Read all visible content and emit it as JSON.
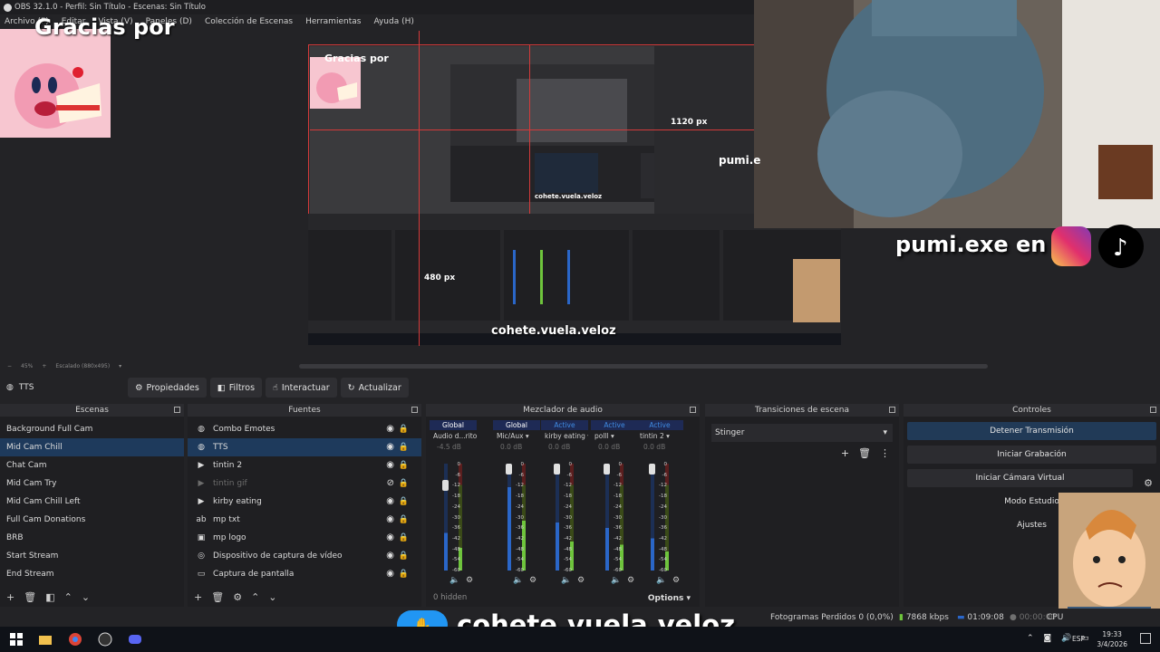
{
  "window": {
    "title": "OBS 32.1.0 - Perfil: Sin Título - Escenas: Sin Título"
  },
  "menu": [
    "Archivo (F)",
    "Editar",
    "Vista (V)",
    "Paneles (D)",
    "Colección de Escenas",
    "Herramientas",
    "Ayuda (H)"
  ],
  "overlay": {
    "gracias": "Gracias     por",
    "pumi_tag": "pumi.exe en",
    "pumi_small": "pumi.e",
    "px_1120": "1120 px",
    "px_480": "480 px",
    "cohete": "cohete.vuela.veloz"
  },
  "preview_status": {
    "zoom": "45%",
    "scaled": "Escalado (880x495)"
  },
  "source_toolbar": {
    "current_source": "TTS",
    "buttons": [
      "Propiedades",
      "Filtros",
      "Interactuar",
      "Actualizar"
    ]
  },
  "scenes": {
    "title": "Escenas",
    "items": [
      "Background Full Cam",
      "Mid Cam Chill",
      "Chat Cam",
      "Mid Cam Try",
      "Mid Cam Chill Left",
      "Full Cam Donations",
      "BRB",
      "Start Stream",
      "End Stream"
    ],
    "active_index": 1
  },
  "sources": {
    "title": "Fuentes",
    "items": [
      {
        "label": "Combo Emotes",
        "icon": "browser-icon",
        "glyph": "◍",
        "dim": false
      },
      {
        "label": "TTS",
        "icon": "browser-icon",
        "glyph": "◍",
        "dim": false
      },
      {
        "label": "tintin 2",
        "icon": "media-play-icon",
        "glyph": "▶",
        "dim": false
      },
      {
        "label": "tintin gif",
        "icon": "media-play-icon",
        "glyph": "▶",
        "dim": true
      },
      {
        "label": "kirby eating",
        "icon": "media-play-icon",
        "glyph": "▶",
        "dim": false
      },
      {
        "label": "mp txt",
        "icon": "text-icon",
        "glyph": "ab",
        "dim": false
      },
      {
        "label": "mp logo",
        "icon": "image-icon",
        "glyph": "▣",
        "dim": false
      },
      {
        "label": "Dispositivo de captura de vídeo",
        "icon": "camera-icon",
        "glyph": "◎",
        "dim": false
      },
      {
        "label": "Captura de pantalla",
        "icon": "monitor-icon",
        "glyph": "▭",
        "dim": false
      }
    ],
    "active_index": 1
  },
  "mixer": {
    "title": "Mezclador de audio",
    "channels": [
      {
        "head": "Global",
        "name": "Audio d...ritorio",
        "db": "-4.5 dB",
        "active": false
      },
      {
        "head": "Global",
        "name": "Mic/Aux",
        "db": "0.0 dB",
        "active": false
      },
      {
        "head": "Active",
        "name": "kirby eating",
        "db": "0.0 dB",
        "active": true
      },
      {
        "head": "Active",
        "name": "polll",
        "db": "0.0 dB",
        "active": true
      },
      {
        "head": "Active",
        "name": "tintin 2",
        "db": "0.0 dB",
        "active": true
      }
    ],
    "scale": [
      "0",
      "-6",
      "-12",
      "-18",
      "-24",
      "-30",
      "-36",
      "-42",
      "-48",
      "-54",
      "-60"
    ],
    "hidden": "0 hidden",
    "options": "Options"
  },
  "transitions": {
    "title": "Transiciones de escena",
    "selected": "Stinger"
  },
  "controls": {
    "title": "Controles",
    "buttons": [
      "Detener Transmisión",
      "Iniciar Grabación",
      "Iniciar Cámara Virtual",
      "Modo Estudio",
      "Ajustes"
    ]
  },
  "status": {
    "frames_dropped": "Fotogramas Perdidos 0 (0,0%)",
    "kbps": "7868 kbps",
    "live_time": "01:09:08",
    "rec_time": "00:00:00",
    "cpu": "CPU"
  },
  "taskbar": {
    "lang": "ESP",
    "time": "19:33",
    "date": "3/4/2026"
  },
  "colors": {
    "accent": "#1e3a5c",
    "record_red": "#d43a3a",
    "meter_blue": "#2a66c8",
    "meter_green": "#6ec43c"
  }
}
